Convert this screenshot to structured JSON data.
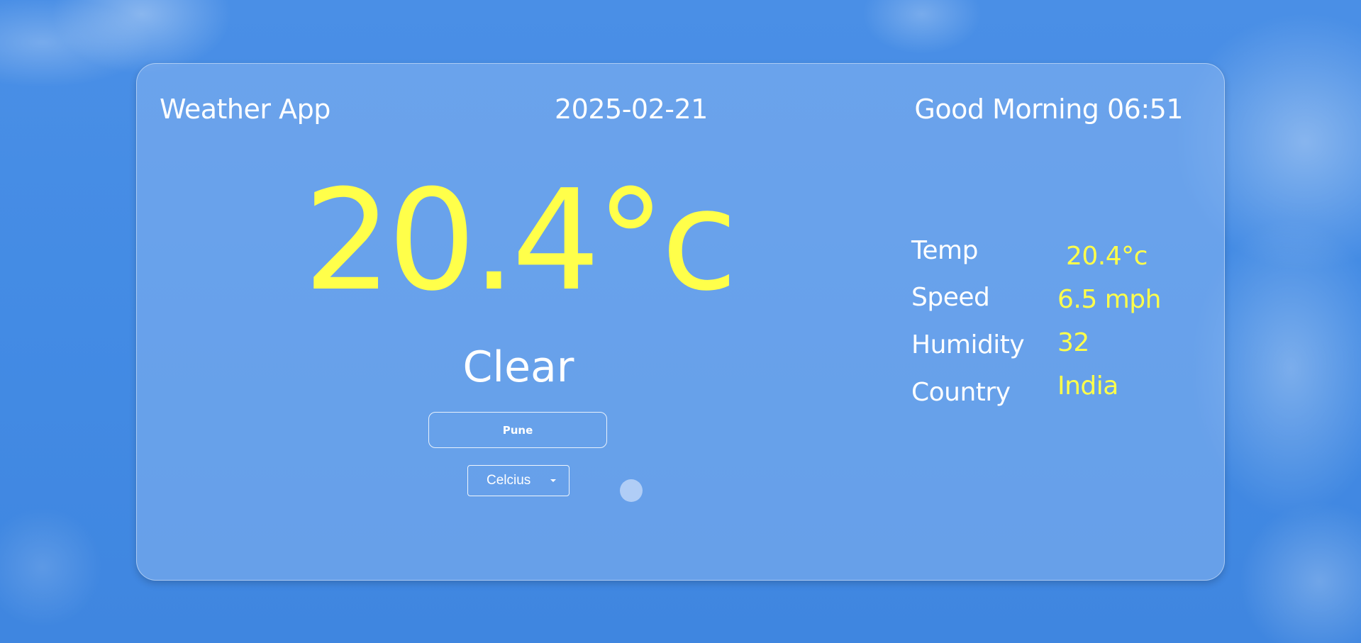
{
  "header": {
    "app_title": "Weather App",
    "date": "2025-02-21",
    "greeting": "Good Morning 06:51"
  },
  "main": {
    "temperature": "20.4°c",
    "condition": "Clear",
    "city_value": "Pune",
    "unit_selected": "Celcius"
  },
  "details": {
    "temp_label": "Temp",
    "temp_value": "20.4°c",
    "speed_label": "Speed",
    "speed_value": "6.5 mph",
    "humidity_label": "Humidity",
    "humidity_value": "32",
    "country_label": "Country",
    "country_value": "India"
  },
  "colors": {
    "background": "#438be4",
    "accent_yellow": "#ffff4a",
    "text_white": "#ffffff"
  }
}
